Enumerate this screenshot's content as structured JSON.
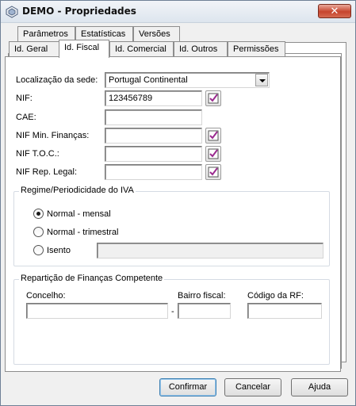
{
  "window": {
    "title": "DEMO - Propriedades",
    "close_glyph": "✕"
  },
  "tabs_row1": [
    "Parâmetros",
    "Estatísticas",
    "Versões"
  ],
  "tabs_row2": [
    "Id. Geral",
    "Id. Fiscal",
    "Id. Comercial",
    "Id. Outros",
    "Permissões"
  ],
  "active_tab": "Id. Fiscal",
  "form": {
    "sede_label": "Localização da sede:",
    "sede_value": "Portugal Continental",
    "nif_label": "NIF:",
    "nif_value": "123456789",
    "cae_label": "CAE:",
    "cae_value": "",
    "nif_min_label": "NIF Min. Finanças:",
    "nif_min_value": "",
    "nif_toc_label": "NIF T.O.C.:",
    "nif_toc_value": "",
    "nif_rep_label": "NIF Rep. Legal:",
    "nif_rep_value": ""
  },
  "iva": {
    "title": "Regime/Periodicidade do IVA",
    "options": [
      "Normal - mensal",
      "Normal - trimestral",
      "Isento"
    ],
    "selected": "Normal - mensal",
    "isento_value": ""
  },
  "financas": {
    "title": "Repartição de Finanças Competente",
    "concelho_label": "Concelho:",
    "concelho_value": "",
    "separator": "-",
    "bairro_label": "Bairro fiscal:",
    "bairro_value": "",
    "codigo_label": "Código da RF:",
    "codigo_value": ""
  },
  "buttons": {
    "confirmar": "Confirmar",
    "cancelar": "Cancelar",
    "ajuda": "Ajuda"
  },
  "colors": {
    "accent_check": "#9b2a8f",
    "close_red": "#c7442d"
  }
}
